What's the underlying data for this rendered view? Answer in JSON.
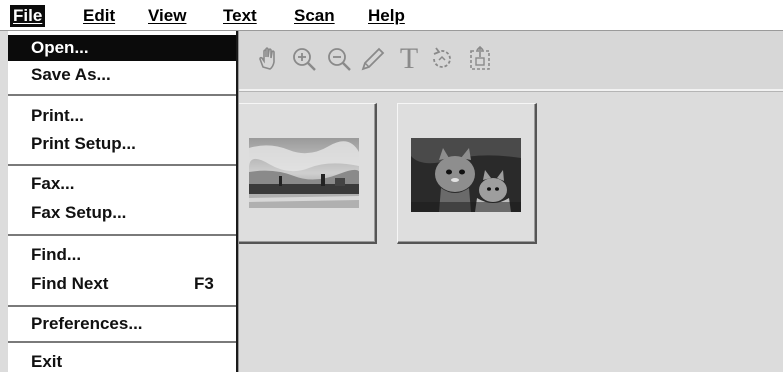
{
  "menubar": {
    "items": [
      "File",
      "Edit",
      "View",
      "Text",
      "Scan",
      "Help"
    ],
    "active": "File"
  },
  "file_menu": {
    "items": [
      {
        "label": "Open...",
        "shortcut": ""
      },
      {
        "label": "Save As...",
        "shortcut": ""
      },
      {
        "label": "Print...",
        "shortcut": ""
      },
      {
        "label": "Print Setup...",
        "shortcut": ""
      },
      {
        "label": "Fax...",
        "shortcut": ""
      },
      {
        "label": "Fax Setup...",
        "shortcut": ""
      },
      {
        "label": "Find...",
        "shortcut": ""
      },
      {
        "label": "Find Next",
        "shortcut": "F3"
      },
      {
        "label": "Preferences...",
        "shortcut": ""
      },
      {
        "label": "Exit",
        "shortcut": ""
      }
    ],
    "selected": "Open..."
  },
  "toolbar": {
    "tools": [
      "hand-icon",
      "zoom-in-icon",
      "zoom-out-icon",
      "pencil-icon",
      "text-tool-icon",
      "rotate-icon",
      "select-icon"
    ],
    "text_tool_glyph": "T"
  },
  "thumbnails": [
    {
      "name": "landscape-photo"
    },
    {
      "name": "cat-photo"
    }
  ],
  "colors": {
    "workspace": "#dcdcdc",
    "selection": "#0b0b0b",
    "icon": "#8a8a8a"
  }
}
